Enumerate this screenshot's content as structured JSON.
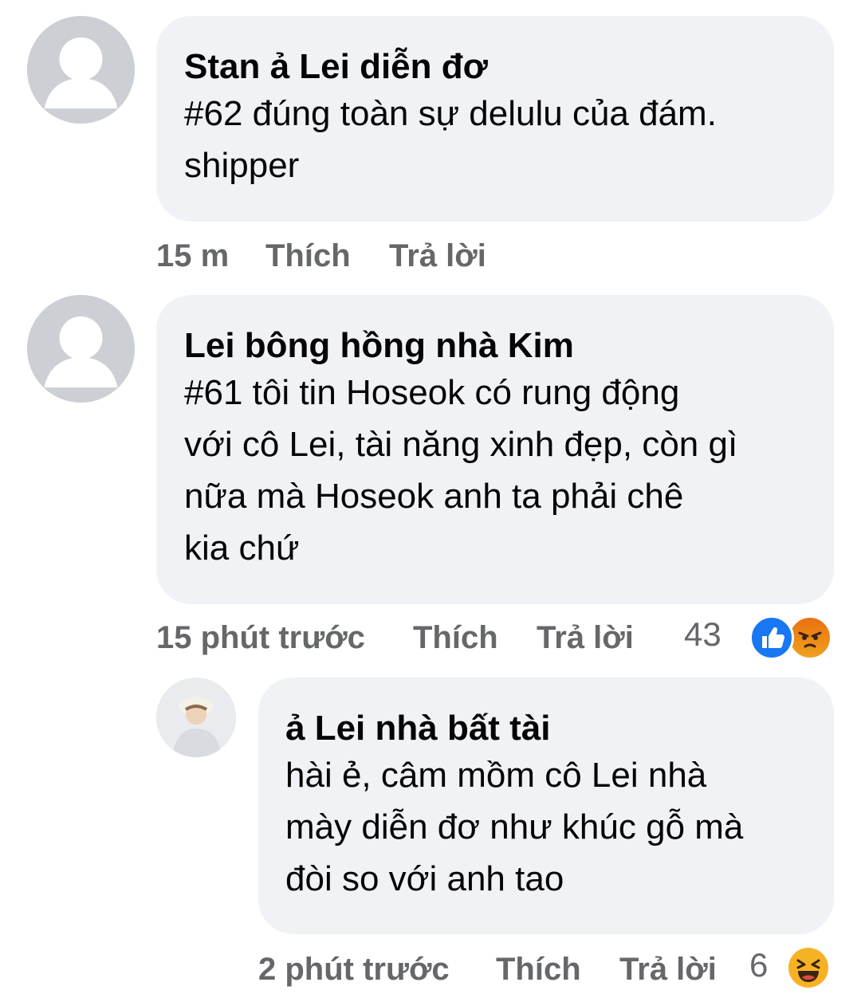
{
  "comments": [
    {
      "author": "Stan ả Lei diễn đơ",
      "lines": [
        "#62 đúng toàn sự delulu của đám.",
        "shipper"
      ],
      "time": "15 m",
      "like_label": "Thích",
      "reply_label": "Trả lời",
      "avatar_icon": "default-user-icon"
    },
    {
      "author": "Lei bông hồng nhà Kim",
      "lines": [
        "#61 tôi tin Hoseok có rung động",
        "với cô Lei, tài năng xinh đẹp, còn gì",
        "nữa mà Hoseok anh ta phải chê",
        "kia chứ"
      ],
      "time": "15 phút trước",
      "like_label": "Thích",
      "reply_label": "Trả lời",
      "reaction_count": "43",
      "reactions": [
        "like-icon",
        "angry-icon"
      ],
      "avatar_icon": "default-user-icon"
    },
    {
      "author": "ả Lei nhà bất tài",
      "lines": [
        "hài ẻ, câm mồm cô Lei nhà",
        "mày diễn đơ như khúc gỗ mà",
        "đòi so với anh tao"
      ],
      "time": "2 phút trước",
      "like_label": "Thích",
      "reply_label": "Trả lời",
      "reaction_count": "6",
      "reactions": [
        "haha-icon"
      ],
      "avatar_icon": "profile-photo"
    }
  ],
  "colors": {
    "bubble": "#f0f2f5",
    "text": "#050505",
    "meta": "#65676b",
    "like_blue": "#1877f2",
    "angry_orange": "#e9710f",
    "haha_yellow": "#f7b125"
  }
}
